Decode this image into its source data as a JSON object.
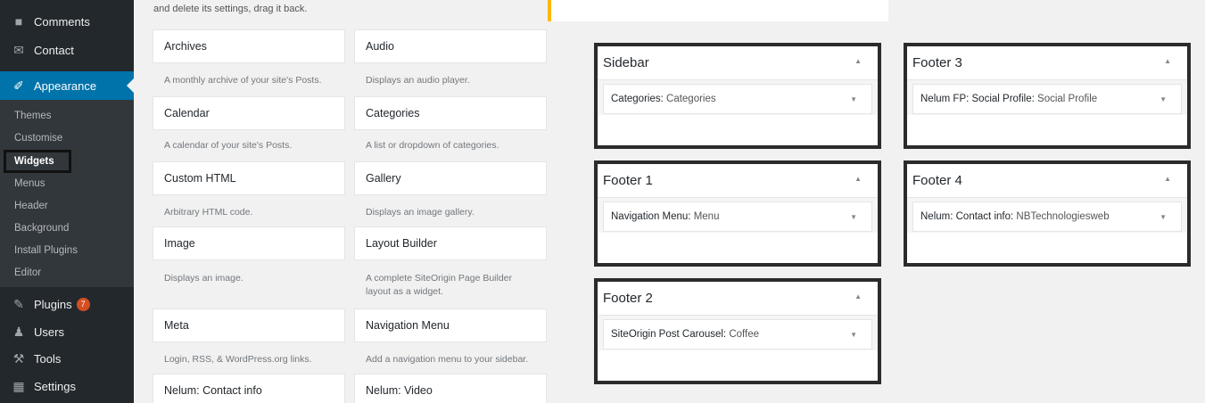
{
  "menu": {
    "comments": "Comments",
    "contact": "Contact",
    "appearance": "Appearance",
    "plugins": "Plugins",
    "plugins_badge": "7",
    "users": "Users",
    "tools": "Tools",
    "settings": "Settings"
  },
  "submenu": {
    "themes": "Themes",
    "customise": "Customise",
    "widgets": "Widgets",
    "menus": "Menus",
    "header": "Header",
    "background": "Background",
    "install_plugins": "Install Plugins",
    "editor": "Editor"
  },
  "available": {
    "top_text": "and delete its settings, drag it back.",
    "widgets": [
      {
        "title": "Archives",
        "desc": "A monthly archive of your site's Posts."
      },
      {
        "title": "Audio",
        "desc": "Displays an audio player."
      },
      {
        "title": "Calendar",
        "desc": "A calendar of your site's Posts."
      },
      {
        "title": "Categories",
        "desc": "A list or dropdown of categories."
      },
      {
        "title": "Custom HTML",
        "desc": "Arbitrary HTML code."
      },
      {
        "title": "Gallery",
        "desc": "Displays an image gallery."
      },
      {
        "title": "Image",
        "desc": "Displays an image."
      },
      {
        "title": "Layout Builder",
        "desc": "A complete SiteOrigin Page Builder layout as a widget."
      },
      {
        "title": "Meta",
        "desc": "Login, RSS, & WordPress.org links."
      },
      {
        "title": "Navigation Menu",
        "desc": "Add a navigation menu to your sidebar."
      },
      {
        "title": "Nelum: Contact info",
        "desc": ""
      },
      {
        "title": "Nelum: Video",
        "desc": ""
      }
    ]
  },
  "areas": {
    "sidebar": {
      "title": "Sidebar",
      "widget_type": "Categories:",
      "widget_label": "Categories"
    },
    "footer1": {
      "title": "Footer 1",
      "widget_type": "Navigation Menu:",
      "widget_label": "Menu"
    },
    "footer2": {
      "title": "Footer 2",
      "widget_type": "SiteOrigin Post Carousel:",
      "widget_label": "Coffee"
    },
    "footer3": {
      "title": "Footer 3",
      "widget_type": "Nelum FP: Social Profile:",
      "widget_label": "Social Profile"
    },
    "footer4": {
      "title": "Footer 4",
      "widget_type": "Nelum: Contact info:",
      "widget_label": "NBTechnologiesweb"
    }
  },
  "icons": {
    "collapse": "▲",
    "expand": "▼"
  },
  "colors": {
    "admin_bar": "#23282d",
    "active_menu": "#0073aa",
    "notice": "#ffb900"
  }
}
